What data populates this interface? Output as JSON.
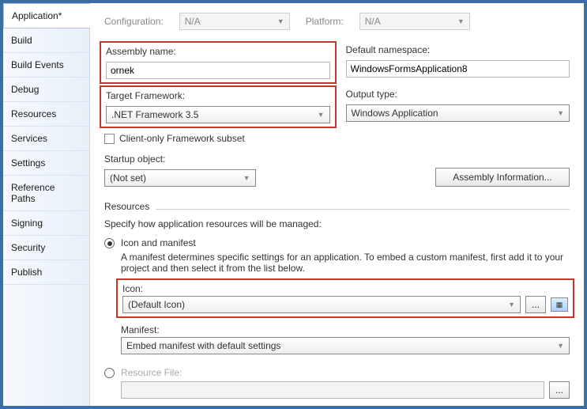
{
  "sidebar": {
    "items": [
      {
        "label": "Application*"
      },
      {
        "label": "Build"
      },
      {
        "label": "Build Events"
      },
      {
        "label": "Debug"
      },
      {
        "label": "Resources"
      },
      {
        "label": "Services"
      },
      {
        "label": "Settings"
      },
      {
        "label": "Reference Paths"
      },
      {
        "label": "Signing"
      },
      {
        "label": "Security"
      },
      {
        "label": "Publish"
      }
    ]
  },
  "top": {
    "config_label": "Configuration:",
    "config_value": "N/A",
    "platform_label": "Platform:",
    "platform_value": "N/A"
  },
  "assembly": {
    "name_label": "Assembly name:",
    "name_value": "ornek",
    "namespace_label": "Default namespace:",
    "namespace_value": "WindowsFormsApplication8"
  },
  "framework": {
    "target_label": "Target Framework:",
    "target_value": ".NET Framework 3.5",
    "output_label": "Output type:",
    "output_value": "Windows Application"
  },
  "client_subset": {
    "label": "Client-only Framework subset"
  },
  "startup": {
    "label": "Startup object:",
    "value": "(Not set)",
    "assembly_info_btn": "Assembly Information..."
  },
  "resources": {
    "title": "Resources",
    "desc": "Specify how application resources will be managed:",
    "icon_manifest_label": "Icon and manifest",
    "icon_manifest_desc": "A manifest determines specific settings for an application. To embed a custom manifest, first add it to your project and then select it from the list below.",
    "icon_label": "Icon:",
    "icon_value": "(Default Icon)",
    "browse": "...",
    "manifest_label": "Manifest:",
    "manifest_value": "Embed manifest with default settings",
    "resource_file_label": "Resource File:"
  }
}
